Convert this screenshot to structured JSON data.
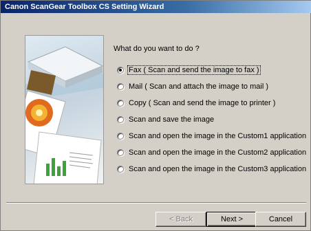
{
  "window": {
    "title": "Canon ScanGear Toolbox CS Setting Wizard"
  },
  "prompt": "What do you want to do ?",
  "options": [
    {
      "label": "Fax ( Scan and send the image to fax )",
      "selected": true
    },
    {
      "label": "Mail ( Scan and attach the image to mail )",
      "selected": false
    },
    {
      "label": "Copy ( Scan and send the image to printer )",
      "selected": false
    },
    {
      "label": "Scan and save the image",
      "selected": false
    },
    {
      "label": "Scan and open the image in the Custom1 application",
      "selected": false
    },
    {
      "label": "Scan and open the image in the Custom2 application",
      "selected": false
    },
    {
      "label": "Scan and open the image in the Custom3 application",
      "selected": false
    }
  ],
  "buttons": {
    "back": "< Back",
    "next": "Next >",
    "cancel": "Cancel"
  },
  "colors": {
    "title_start": "#0a246a",
    "title_end": "#a6caf0",
    "face": "#d4d0c8"
  }
}
